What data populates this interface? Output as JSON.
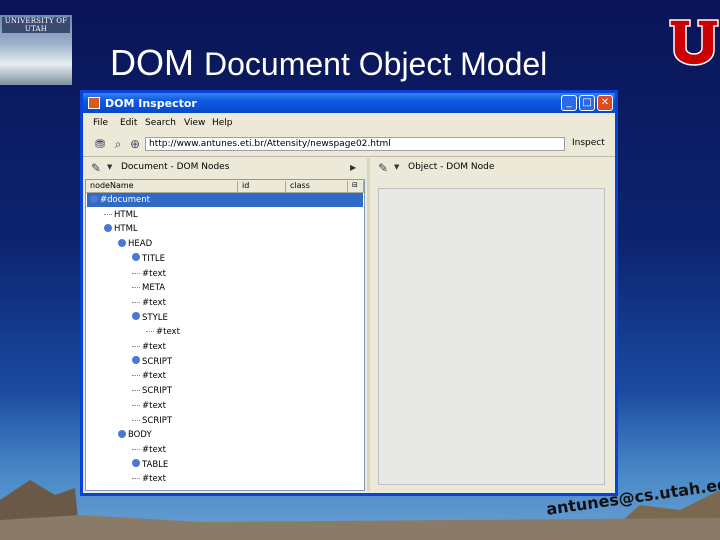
{
  "slide": {
    "title_main": "DOM",
    "title_sub": "Document Object Model",
    "university_logo_text": "UNIVERSITY OF UTAH",
    "email": "antunes@cs.utah.edu"
  },
  "window": {
    "title": "DOM Inspector",
    "menu": [
      "File",
      "Edit",
      "Search",
      "View",
      "Help"
    ],
    "url": "http://www.antunes.eti.br/Attensity/newspage02.html",
    "inspect_label": "Inspect",
    "left_pane_title": "Document - DOM Nodes",
    "right_pane_title": "Object - DOM Node",
    "columns": [
      "nodeName",
      "id",
      "class"
    ],
    "tree": [
      {
        "label": "#document",
        "level": 0,
        "toggle": true,
        "selected": true
      },
      {
        "label": "HTML",
        "level": 1,
        "toggle": false
      },
      {
        "label": "HTML",
        "level": 1,
        "toggle": true
      },
      {
        "label": "HEAD",
        "level": 2,
        "toggle": true
      },
      {
        "label": "TITLE",
        "level": 3,
        "toggle": true
      },
      {
        "label": "#text",
        "level": 3,
        "toggle": false
      },
      {
        "label": "META",
        "level": 3,
        "toggle": false
      },
      {
        "label": "#text",
        "level": 3,
        "toggle": false
      },
      {
        "label": "STYLE",
        "level": 3,
        "toggle": true
      },
      {
        "label": "#text",
        "level": 4,
        "toggle": false
      },
      {
        "label": "#text",
        "level": 3,
        "toggle": false
      },
      {
        "label": "SCRIPT",
        "level": 3,
        "toggle": true
      },
      {
        "label": "#text",
        "level": 3,
        "toggle": false
      },
      {
        "label": "SCRIPT",
        "level": 3,
        "toggle": false
      },
      {
        "label": "#text",
        "level": 3,
        "toggle": false
      },
      {
        "label": "SCRIPT",
        "level": 3,
        "toggle": false
      },
      {
        "label": "BODY",
        "level": 2,
        "toggle": true
      },
      {
        "label": "#text",
        "level": 3,
        "toggle": false
      },
      {
        "label": "TABLE",
        "level": 3,
        "toggle": true
      },
      {
        "label": "#text",
        "level": 3,
        "toggle": false
      }
    ]
  },
  "colors": {
    "titlebar": "#0a5ae0",
    "selection": "#316ac5",
    "window_bg": "#ece9d8",
    "utah_red": "#cc0000"
  },
  "icons": [
    "app-icon",
    "minimize-icon",
    "maximize-icon",
    "close-icon",
    "node-picker-icon",
    "search-icon",
    "globe-icon",
    "chevron-down-icon",
    "chevron-right-icon",
    "column-picker-icon"
  ]
}
